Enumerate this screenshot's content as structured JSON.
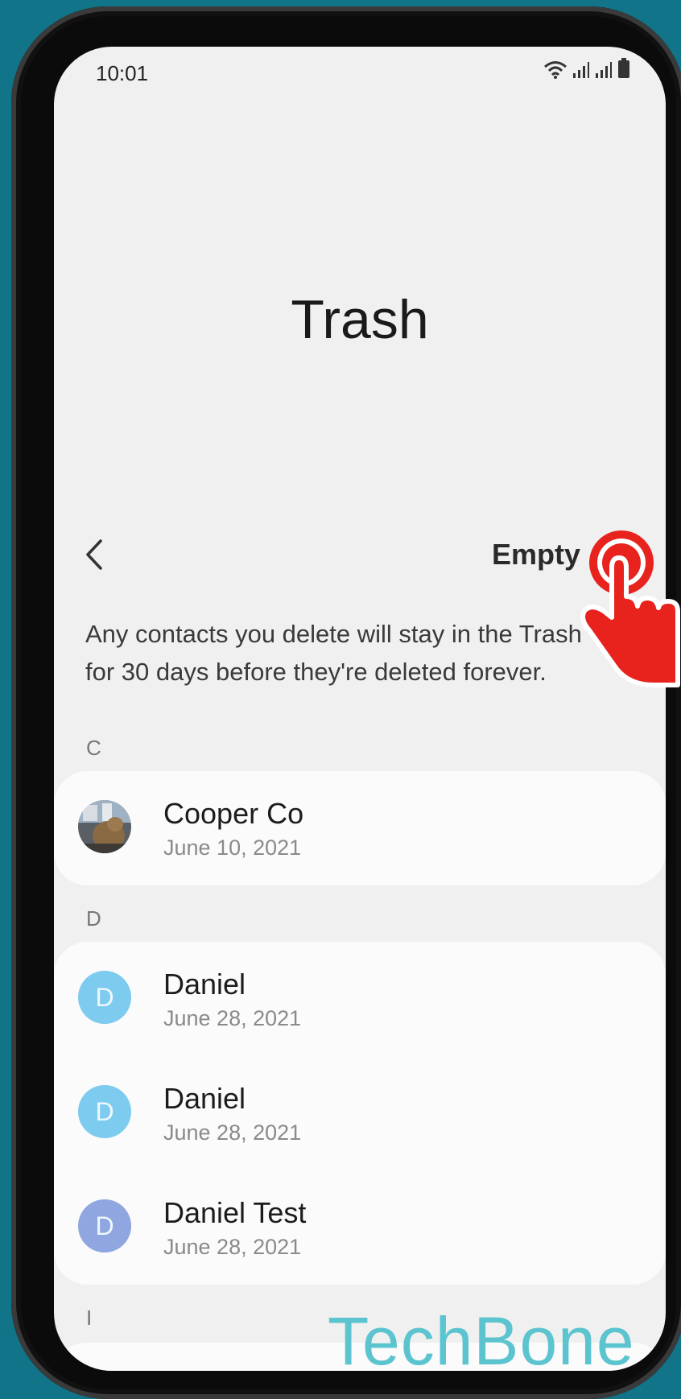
{
  "status_bar": {
    "time": "10:01"
  },
  "page": {
    "title": "Trash"
  },
  "toolbar": {
    "empty_label": "Empty"
  },
  "info_text": "Any contacts you delete will stay in the Trash for 30 days before they're deleted forever.",
  "sections": [
    {
      "letter": "C",
      "contacts": [
        {
          "name": "Cooper Co",
          "date": "June 10, 2021",
          "avatar": "photo"
        }
      ]
    },
    {
      "letter": "D",
      "contacts": [
        {
          "name": "Daniel",
          "date": "June 28, 2021",
          "initial": "D",
          "avatar_color": "#7ecbf0"
        },
        {
          "name": "Daniel",
          "date": "June 28, 2021",
          "initial": "D",
          "avatar_color": "#7ecbf0"
        },
        {
          "name": "Daniel Test",
          "date": "June 28, 2021",
          "initial": "D",
          "avatar_color": "#8fa6e0"
        }
      ]
    },
    {
      "letter": "I",
      "contacts": []
    }
  ],
  "watermark": "TechBone",
  "colors": {
    "background": "#127488",
    "tap_indicator": "#e8231e",
    "watermark": "#5cc4cf"
  }
}
